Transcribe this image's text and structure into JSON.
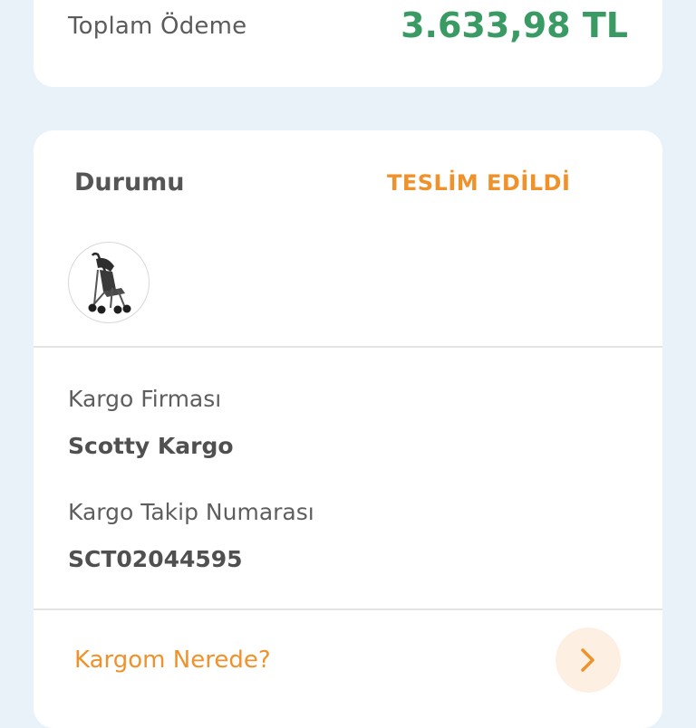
{
  "payment": {
    "total_label": "Toplam Ödeme",
    "total_value": "3.633,98 TL"
  },
  "order": {
    "status_label": "Durumu",
    "status_value": "TESLİM EDİLDİ",
    "product_icon": "stroller-icon",
    "cargo_company_label": "Kargo Firması",
    "cargo_company_value": "Scotty Kargo",
    "tracking_label": "Kargo Takip Numarası",
    "tracking_value": "SCT02044595",
    "where_link": "Kargom Nerede?",
    "where_icon": "chevron-right-icon"
  },
  "colors": {
    "background": "#eaf2f9",
    "total_green": "#3a9a63",
    "accent_orange": "#f0922b"
  }
}
